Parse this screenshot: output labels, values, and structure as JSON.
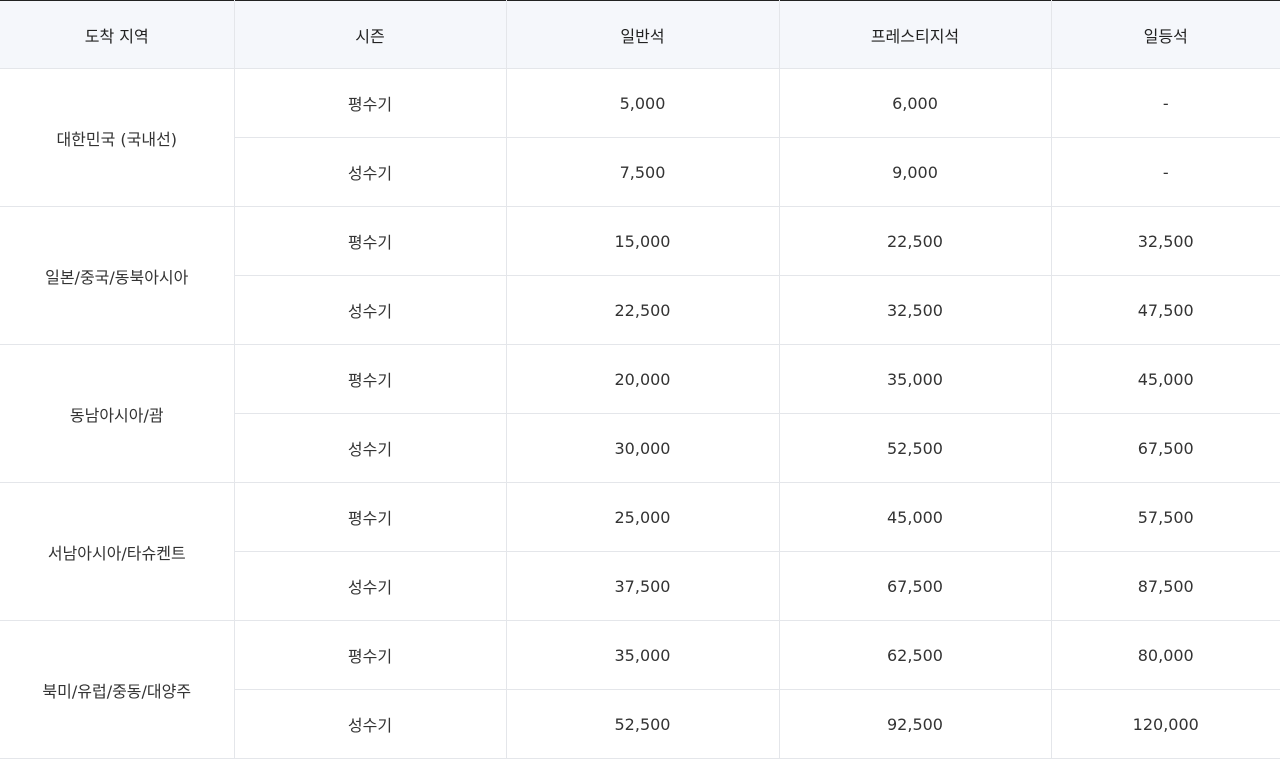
{
  "table": {
    "headers": [
      "도착 지역",
      "시즌",
      "일반석",
      "프레스티지석",
      "일등석"
    ],
    "groups": [
      {
        "region": "대한민국 (국내선)",
        "rows": [
          {
            "season": "평수기",
            "economy": "5,000",
            "prestige": "6,000",
            "first": "-"
          },
          {
            "season": "성수기",
            "economy": "7,500",
            "prestige": "9,000",
            "first": "-"
          }
        ]
      },
      {
        "region": "일본/중국/동북아시아",
        "rows": [
          {
            "season": "평수기",
            "economy": "15,000",
            "prestige": "22,500",
            "first": "32,500"
          },
          {
            "season": "성수기",
            "economy": "22,500",
            "prestige": "32,500",
            "first": "47,500"
          }
        ]
      },
      {
        "region": "동남아시아/괌",
        "rows": [
          {
            "season": "평수기",
            "economy": "20,000",
            "prestige": "35,000",
            "first": "45,000"
          },
          {
            "season": "성수기",
            "economy": "30,000",
            "prestige": "52,500",
            "first": "67,500"
          }
        ]
      },
      {
        "region": "서남아시아/타슈켄트",
        "rows": [
          {
            "season": "평수기",
            "economy": "25,000",
            "prestige": "45,000",
            "first": "57,500"
          },
          {
            "season": "성수기",
            "economy": "37,500",
            "prestige": "67,500",
            "first": "87,500"
          }
        ]
      },
      {
        "region": "북미/유럽/중동/대양주",
        "rows": [
          {
            "season": "평수기",
            "economy": "35,000",
            "prestige": "62,500",
            "first": "80,000"
          },
          {
            "season": "성수기",
            "economy": "52,500",
            "prestige": "92,500",
            "first": "120,000"
          }
        ]
      }
    ]
  }
}
